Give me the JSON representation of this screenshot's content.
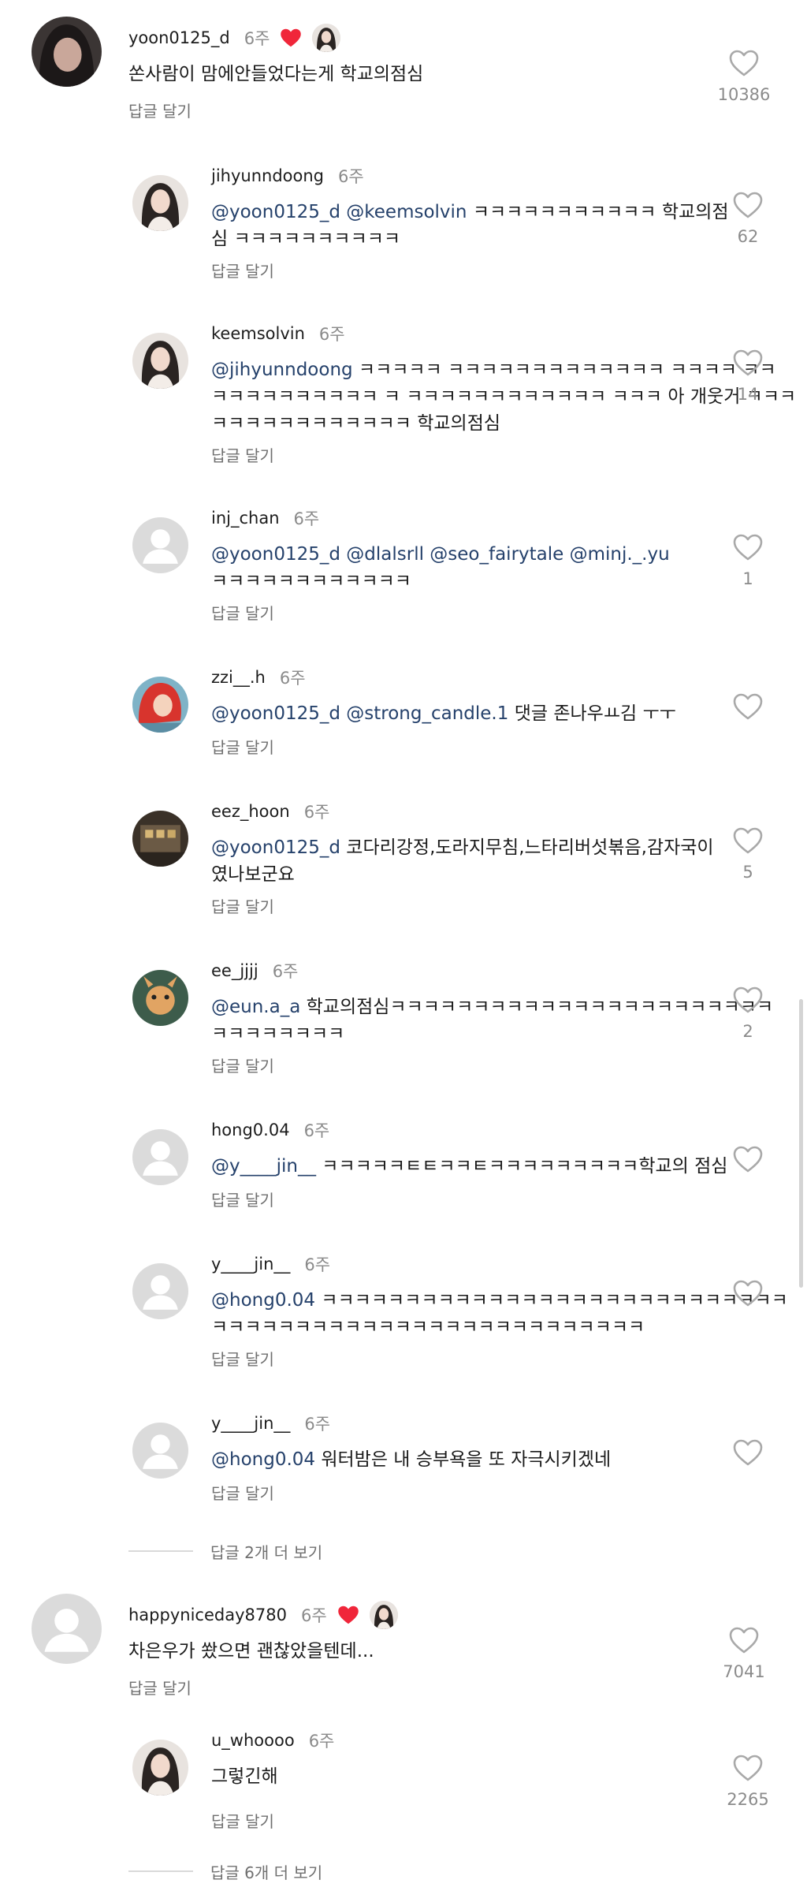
{
  "reply_label": "답글 달기",
  "threads": [
    {
      "username": "yoon0125_d",
      "age": "6주",
      "creator_liked": true,
      "text": "쏜사람이 맘에안들었다는게 학교의점심",
      "likes": "10386",
      "avatar_icon": "dark-portrait-avatar",
      "replies": [
        {
          "username": "jihyunndoong",
          "age": "6주",
          "mentions": "@yoon0125_d @keemsolvin",
          "text": " ㅋㅋㅋㅋㅋㅋㅋㅋㅋㅋㅋ 학교의점",
          "text2": "심 ㅋㅋㅋㅋㅋㅋㅋㅋㅋㅋ",
          "likes": "62",
          "avatar_icon": "woman-portrait-avatar"
        },
        {
          "username": "keemsolvin",
          "age": "6주",
          "mentions": "@jihyunndoong",
          "text": " ㅋㅋㅋㅋㅋ ㅋㅋㅋㅋㅋㅋㅋㅋㅋㅋㅋㅋㅋ ㅋㅋㅋㅋ ㅋㅋ",
          "text2": "ㅋㅋㅋㅋㅋㅋㅋㅋㅋㅋ ㅋ ㅋㅋㅋㅋㅋㅋㅋㅋㅋㅋㅋㅋ ㅋㅋㅋ 아 개웃거 ㅋㅋㅋ",
          "text3": "ㅋㅋㅋㅋㅋㅋㅋㅋㅋㅋㅋㅋ 학교의점심",
          "likes": "14",
          "avatar_icon": "woman-portrait-avatar"
        },
        {
          "username": "inj_chan",
          "age": "6주",
          "mentions": "@yoon0125_d  @dlalsrll @seo_fairytale @minj._.yu",
          "text": "",
          "text2": "ㅋㅋㅋㅋㅋㅋㅋㅋㅋㅋㅋㅋ",
          "likes": "1",
          "avatar_icon": "default-user-avatar"
        },
        {
          "username": "zzi__.h",
          "age": "6주",
          "mentions": "@yoon0125_d @strong_candle.1",
          "text": "  댓글 존나우ㅛ김 ㅜㅜ",
          "likes": "",
          "avatar_icon": "mermaid-avatar"
        },
        {
          "username": "eez_hoon",
          "age": "6주",
          "mentions": "@yoon0125_d",
          "text": " 코다리강정,도라지무침,느타리버섯볶음,감자국이",
          "text2": "였나보군요",
          "likes": "5",
          "avatar_icon": "building-photo-avatar"
        },
        {
          "username": "ee_jjjj",
          "age": "6주",
          "mentions": "@eun.a_a",
          "text": " 학교의점심ㅋㅋㅋㅋㅋㅋㅋㅋㅋㅋㅋㅋㅋㅋㅋㅋㅋㅋㅋㅋㅋㅋㅋ",
          "text2": "ㅋㅋㅋㅋㅋㅋㅋㅋ",
          "likes": "2",
          "avatar_icon": "cartoon-avatar"
        },
        {
          "username": "hong0.04",
          "age": "6주",
          "mentions": "@y____jin__",
          "text": "  ㅋㅋㅋㅋㅋㅌㅌㅋㅋㅌㅋㅋㅋㅋㅋㅋㅋㅋㅋ학교의 점심",
          "likes": "",
          "avatar_icon": "default-user-avatar"
        },
        {
          "username": "y____jin__",
          "age": "6주",
          "mentions": "@hong0.04",
          "text": " ㅋㅋㅋㅋㅋㅋㅋㅋㅋㅋㅋㅋㅋㅋㅋㅋㅋㅋㅋㅋㅋㅋㅋㅋㅋㅋㅋㅋ",
          "text2": "ㅋㅋㅋㅋㅋㅋㅋㅋㅋㅋㅋㅋㅋㅋㅋㅋㅋㅋㅋㅋㅋㅋㅋㅋㅋㅋ",
          "likes": "",
          "avatar_icon": "default-user-avatar"
        },
        {
          "username": "y____jin__",
          "age": "6주",
          "mentions": "@hong0.04",
          "text": " 워터밤은 내 승부욕을 또 자극시키겠네",
          "likes": "",
          "avatar_icon": "default-user-avatar"
        }
      ],
      "more_replies": "답글 2개 더 보기"
    },
    {
      "username": "happyniceday8780",
      "age": "6주",
      "creator_liked": true,
      "text": "차은우가 쐈으면 괜찮았을텐데...",
      "likes": "7041",
      "avatar_icon": "default-user-avatar",
      "replies": [
        {
          "username": "u_whoooo",
          "age": "6주",
          "mentions": "",
          "text": "그렇긴해",
          "likes": "2265",
          "avatar_icon": "woman-portrait-avatar"
        }
      ],
      "more_replies": "답글 6개 더 보기"
    }
  ],
  "colors": {
    "heart_red": "#f0263a",
    "mention": "#25416b",
    "muted": "#8a8a8a"
  }
}
